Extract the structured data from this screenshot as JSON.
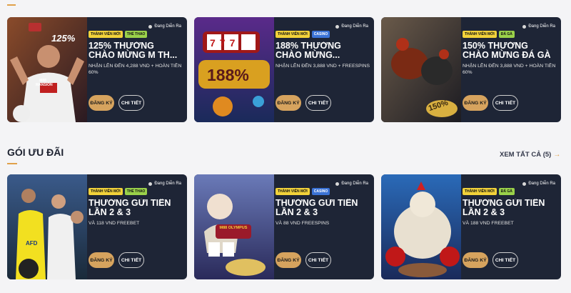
{
  "featured": [
    {
      "status": "Đang Diễn Ra",
      "tags": [
        {
          "label": "THÀNH VIÊN MỚI",
          "kind": "new"
        },
        {
          "label": "THỂ THAO",
          "kind": "sport"
        }
      ],
      "title": "125% THƯỞNG CHÀO MỪNG M TH...",
      "desc": "NHẬN LÊN ĐẾN 4,288 VND + HOÀN TIỀN 60%",
      "register_label": "ĐĂNG KÝ",
      "detail_label": "CHI TIẾT",
      "art_text": "125%",
      "art_logo": "M88 MANSION"
    },
    {
      "status": "Đang Diễn Ra",
      "tags": [
        {
          "label": "THÀNH VIÊN MỚI",
          "kind": "new"
        },
        {
          "label": "CASINO",
          "kind": "casino"
        }
      ],
      "title": "188% THƯỞNG CHÀO MỪNG...",
      "desc": "NHẬN LÊN ĐẾN 3,888 VND + FREESPINS",
      "register_label": "ĐĂNG KÝ",
      "detail_label": "CHI TIẾT",
      "art_text": "188%",
      "art_logo": "777"
    },
    {
      "status": "Đang Diễn Ra",
      "tags": [
        {
          "label": "THÀNH VIÊN MỚI",
          "kind": "new"
        },
        {
          "label": "ĐÁ GÀ",
          "kind": "cockfight"
        }
      ],
      "title": "150% THƯỞNG CHÀO MỪNG ĐÁ GÀ",
      "desc": "NHẬN LÊN ĐẾN 3,888 VND + HOÀN TIỀN 60%",
      "register_label": "ĐĂNG KÝ",
      "detail_label": "CHI TIẾT",
      "art_text": "150%",
      "art_logo": ""
    }
  ],
  "section": {
    "title": "GÓI ƯU ĐÃI",
    "view_all": "XEM TẤT CẢ (5)"
  },
  "packages": [
    {
      "status": "Đang Diễn Ra",
      "tags": [
        {
          "label": "THÀNH VIÊN MỚI",
          "kind": "new"
        },
        {
          "label": "THỂ THAO",
          "kind": "sport"
        }
      ],
      "title": "THƯỞNG GỬI TIỀN LẦN 2 & 3",
      "desc": "VÀ 118 VND FREEBET",
      "register_label": "ĐĂNG KÝ",
      "detail_label": "CHI TIẾT",
      "art_logo": "AFD"
    },
    {
      "status": "Đang Diễn Ra",
      "tags": [
        {
          "label": "THÀNH VIÊN MỚI",
          "kind": "new"
        },
        {
          "label": "CASINO",
          "kind": "casino"
        }
      ],
      "title": "THƯỞNG GỬI TIỀN LẦN 2 & 3",
      "desc": "VÀ 88 VND FREESPINS",
      "register_label": "ĐĂNG KÝ",
      "detail_label": "CHI TIẾT",
      "art_logo": "M88 OLYMPUS"
    },
    {
      "status": "Đang Diễn Ra",
      "tags": [
        {
          "label": "THÀNH VIÊN MỚI",
          "kind": "new"
        },
        {
          "label": "ĐÁ GÀ",
          "kind": "cockfight"
        }
      ],
      "title": "THƯỞNG GỬI TIỀN LẦN 2 & 3",
      "desc": "VÀ 188 VND FREEBET",
      "register_label": "ĐĂNG KÝ",
      "detail_label": "CHI TIẾT",
      "art_logo": ""
    }
  ],
  "colors": {
    "accent": "#e0a14a",
    "card_bg": "#1e2536",
    "button_gold": "#d6a35e"
  },
  "icons": {
    "view_all_arrow": "arrow-right-icon",
    "status": "live-dot-icon"
  }
}
